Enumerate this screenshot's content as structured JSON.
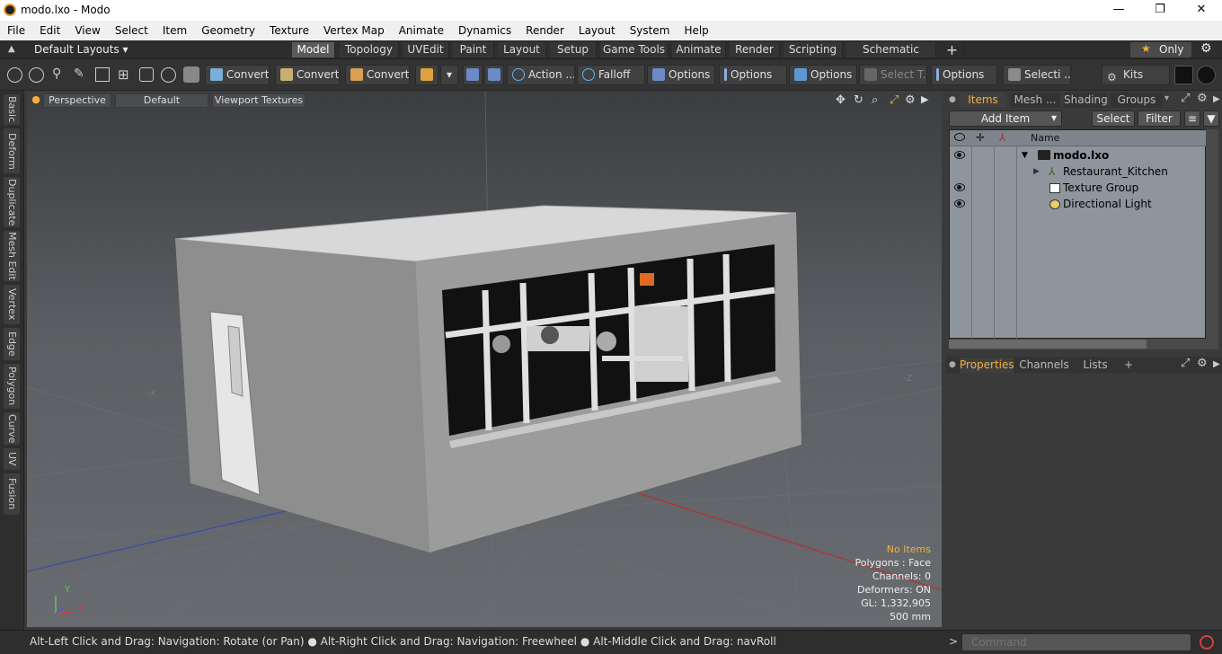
{
  "window": {
    "title": "modo.lxo - Modo",
    "minimize": "—",
    "restore": "❐",
    "close": "✕"
  },
  "menu": [
    "File",
    "Edit",
    "View",
    "Select",
    "Item",
    "Geometry",
    "Texture",
    "Vertex Map",
    "Animate",
    "Dynamics",
    "Render",
    "Layout",
    "System",
    "Help"
  ],
  "layouts": {
    "label": "Default Layouts ▾",
    "only_label": "Only"
  },
  "layout_tabs": [
    "Model",
    "Topology",
    "UVEdit",
    "Paint",
    "Layout",
    "Setup",
    "Game Tools",
    "Animate",
    "Render",
    "Scripting",
    "Schematic Fusion",
    "+"
  ],
  "toolbar": {
    "convert1": "Convert",
    "convert2": "Convert",
    "convert3": "Convert",
    "action": "Action ...",
    "falloff": "Falloff",
    "options1": "Options",
    "options2": "Options",
    "options3": "Options",
    "select_t": "Select T...",
    "options4": "Options",
    "selecti": "Selecti ...",
    "kits": "Kits"
  },
  "left_tabs": [
    "Basic",
    "Deform",
    "Duplicate",
    "Mesh Edit",
    "Vertex",
    "Edge",
    "Polygon",
    "Curve",
    "UV",
    "Fusion"
  ],
  "viewport": {
    "buttons": {
      "perspective": "Perspective",
      "default": "Default",
      "textures": "Viewport Textures"
    },
    "axis_x": "-X",
    "axis_z": "-Z",
    "gizmo": {
      "y": "Y",
      "x": "X"
    },
    "info": {
      "no_items": "No Items",
      "polygons": "Polygons : Face",
      "channels": "Channels: 0",
      "deformers": "Deformers: ON",
      "gl": "GL: 1,332,905",
      "scale": "500 mm"
    }
  },
  "items_panel": {
    "tabs": [
      "Items",
      "Mesh ...",
      "Shading",
      "Groups"
    ],
    "add_item": "Add Item",
    "select": "Select",
    "filter": "Filter",
    "col_name": "Name",
    "tree": [
      {
        "name": "modo.lxo",
        "eye": true
      },
      {
        "name": "Restaurant_Kitchen",
        "eye": false
      },
      {
        "name": "Texture Group",
        "eye": true
      },
      {
        "name": "Directional Light",
        "eye": true
      }
    ]
  },
  "props_panel": {
    "tabs": [
      "Properties",
      "Channels",
      "Lists",
      "+"
    ]
  },
  "status": {
    "hint": "Alt-Left Click and Drag: Navigation: Rotate (or Pan) ● Alt-Right Click and Drag: Navigation: Freewheel ● Alt-Middle Click and Drag: navRoll",
    "command_placeholder": "Command"
  },
  "colors": {
    "accent": "#f0b040",
    "grid_red": "#b83030",
    "grid_blue": "#3a4ab0"
  }
}
